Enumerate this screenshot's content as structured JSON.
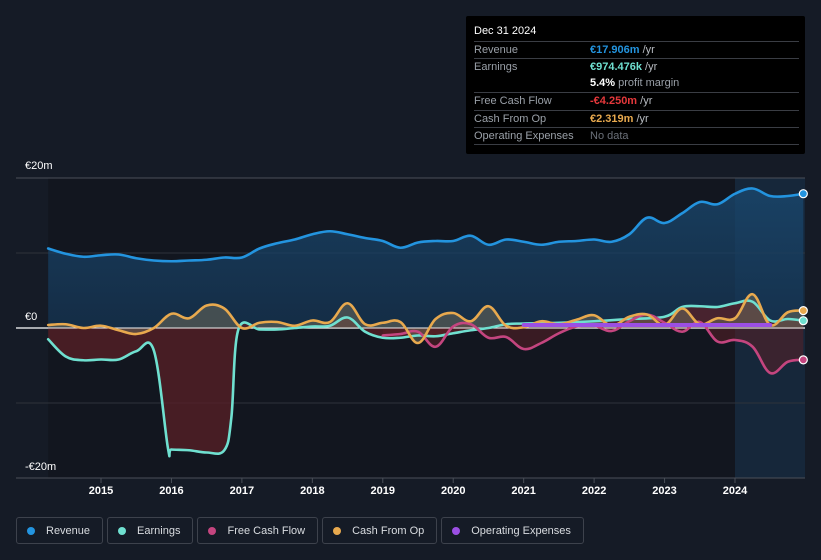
{
  "tooltip": {
    "date": "Dec 31 2024",
    "rows": [
      {
        "label": "Revenue",
        "value": "€17.906m",
        "unit": " /yr",
        "color": "#2394df"
      },
      {
        "label": "Earnings",
        "value": "€974.476k",
        "unit": " /yr",
        "color": "#6fe0d0"
      },
      {
        "label": "",
        "value": "5.4%",
        "unit": " profit margin",
        "color": "#ffffff"
      },
      {
        "label": "Free Cash Flow",
        "value": "-€4.250m",
        "unit": " /yr",
        "color": "#e5383b"
      },
      {
        "label": "Cash From Op",
        "value": "€2.319m",
        "unit": " /yr",
        "color": "#e8a94e"
      },
      {
        "label": "Operating Expenses",
        "value": "No data",
        "unit": "",
        "color": "#6b7079"
      }
    ]
  },
  "legend": [
    {
      "label": "Revenue",
      "color": "#2394df"
    },
    {
      "label": "Earnings",
      "color": "#6fe0d0"
    },
    {
      "label": "Free Cash Flow",
      "color": "#c4457f"
    },
    {
      "label": "Cash From Op",
      "color": "#e8a94e"
    },
    {
      "label": "Operating Expenses",
      "color": "#9b4fe3"
    }
  ],
  "chart_data": {
    "type": "line",
    "title": "",
    "xlabel": "",
    "ylabel": "",
    "y_tick_labels": [
      "€20m",
      "€0",
      "-€20m"
    ],
    "y_ticks": [
      20,
      0,
      -20
    ],
    "ylim": [
      -20,
      20
    ],
    "x_tick_labels": [
      "2015",
      "2016",
      "2017",
      "2018",
      "2019",
      "2020",
      "2021",
      "2022",
      "2023",
      "2024"
    ],
    "x_ticks": [
      2015,
      2016,
      2017,
      2018,
      2019,
      2020,
      2021,
      2022,
      2023,
      2024
    ],
    "xlim": [
      2013.75,
      2025.0
    ],
    "highlight_from": 2024.0,
    "legend_position": "bottom",
    "grid": true,
    "series": [
      {
        "name": "Revenue",
        "color": "#2394df",
        "x": [
          2014.25,
          2014.5,
          2014.75,
          2015.0,
          2015.25,
          2015.5,
          2015.75,
          2016.0,
          2016.25,
          2016.5,
          2016.75,
          2017.0,
          2017.25,
          2017.5,
          2017.75,
          2018.0,
          2018.25,
          2018.5,
          2018.75,
          2019.0,
          2019.25,
          2019.5,
          2019.75,
          2020.0,
          2020.25,
          2020.5,
          2020.75,
          2021.0,
          2021.25,
          2021.5,
          2021.75,
          2022.0,
          2022.25,
          2022.5,
          2022.75,
          2023.0,
          2023.25,
          2023.5,
          2023.75,
          2024.0,
          2024.25,
          2024.5,
          2024.75,
          2024.97
        ],
        "values": [
          10.6,
          9.9,
          9.5,
          9.7,
          9.8,
          9.3,
          9.0,
          8.9,
          9.0,
          9.1,
          9.4,
          9.4,
          10.6,
          11.3,
          11.8,
          12.5,
          12.9,
          12.5,
          12.0,
          11.6,
          10.7,
          11.4,
          11.6,
          11.6,
          12.3,
          11.1,
          11.8,
          11.5,
          11.1,
          11.5,
          11.6,
          11.8,
          11.5,
          12.5,
          14.7,
          14.0,
          15.3,
          16.8,
          16.5,
          17.9,
          18.6,
          17.6,
          17.6,
          17.906
        ]
      },
      {
        "name": "Earnings",
        "color": "#6fe0d0",
        "x": [
          2014.25,
          2014.5,
          2014.75,
          2015.0,
          2015.25,
          2015.5,
          2015.75,
          2015.95,
          2016.0,
          2016.25,
          2016.5,
          2016.75,
          2016.85,
          2016.95,
          2017.25,
          2017.5,
          2017.75,
          2018.0,
          2018.25,
          2018.5,
          2018.75,
          2019.0,
          2019.25,
          2019.5,
          2019.75,
          2020.0,
          2020.25,
          2020.5,
          2020.75,
          2021.0,
          2021.5,
          2022.0,
          2022.5,
          2023.0,
          2023.25,
          2023.5,
          2023.75,
          2024.0,
          2024.25,
          2024.5,
          2024.75,
          2024.97
        ],
        "values": [
          -1.5,
          -3.8,
          -4.3,
          -4.2,
          -4.2,
          -3.1,
          -3.0,
          -16.0,
          -16.2,
          -16.3,
          -16.6,
          -16.3,
          -12.0,
          -0.2,
          -0.2,
          -0.2,
          0.0,
          0.2,
          0.3,
          1.4,
          -0.5,
          -1.3,
          -1.3,
          -1.0,
          -1.1,
          -0.7,
          -0.3,
          0.0,
          0.5,
          0.6,
          0.7,
          0.9,
          1.2,
          1.5,
          2.8,
          2.9,
          2.8,
          3.3,
          3.5,
          1.0,
          1.2,
          0.974
        ]
      },
      {
        "name": "Free Cash Flow",
        "color": "#c4457f",
        "x": [
          2019.0,
          2019.25,
          2019.5,
          2019.75,
          2020.0,
          2020.25,
          2020.5,
          2020.75,
          2021.0,
          2021.25,
          2021.5,
          2021.75,
          2022.0,
          2022.25,
          2022.5,
          2022.75,
          2023.0,
          2023.25,
          2023.5,
          2023.75,
          2024.0,
          2024.25,
          2024.5,
          2024.75,
          2024.97
        ],
        "values": [
          -1.0,
          -0.8,
          -0.5,
          -2.5,
          0.2,
          0.5,
          -1.3,
          -1.2,
          -2.8,
          -2.0,
          -0.7,
          0.2,
          0.3,
          -0.4,
          0.9,
          1.8,
          0.7,
          -0.5,
          0.8,
          -1.8,
          -1.6,
          -2.5,
          -6.0,
          -4.5,
          -4.25
        ]
      },
      {
        "name": "Cash From Op",
        "color": "#e8a94e",
        "x": [
          2014.25,
          2014.5,
          2014.75,
          2015.0,
          2015.25,
          2015.5,
          2015.75,
          2016.0,
          2016.25,
          2016.5,
          2016.75,
          2017.0,
          2017.25,
          2017.5,
          2017.75,
          2018.0,
          2018.25,
          2018.5,
          2018.75,
          2019.0,
          2019.25,
          2019.5,
          2019.75,
          2020.0,
          2020.25,
          2020.5,
          2020.75,
          2021.0,
          2021.25,
          2021.5,
          2021.75,
          2022.0,
          2022.25,
          2022.5,
          2022.75,
          2023.0,
          2023.25,
          2023.5,
          2023.75,
          2024.0,
          2024.25,
          2024.5,
          2024.75,
          2024.97
        ],
        "values": [
          0.4,
          0.5,
          0.0,
          0.3,
          -0.3,
          -0.8,
          0.0,
          1.9,
          1.3,
          3.0,
          2.6,
          0.0,
          0.7,
          0.8,
          0.3,
          1.0,
          0.8,
          3.3,
          0.5,
          0.7,
          0.8,
          -2.0,
          1.2,
          2.0,
          0.9,
          2.9,
          0.3,
          0.1,
          0.9,
          0.5,
          1.1,
          1.7,
          0.3,
          1.5,
          1.8,
          0.4,
          2.6,
          0.5,
          1.3,
          1.3,
          4.5,
          0.4,
          2.1,
          2.319
        ]
      },
      {
        "name": "Operating Expenses",
        "color": "#9b4fe3",
        "x": [
          2021.0,
          2021.5,
          2022.0,
          2022.5,
          2023.0,
          2023.5,
          2024.0,
          2024.5
        ],
        "values": [
          0.4,
          0.4,
          0.4,
          0.4,
          0.4,
          0.4,
          0.4,
          0.4
        ]
      }
    ]
  }
}
